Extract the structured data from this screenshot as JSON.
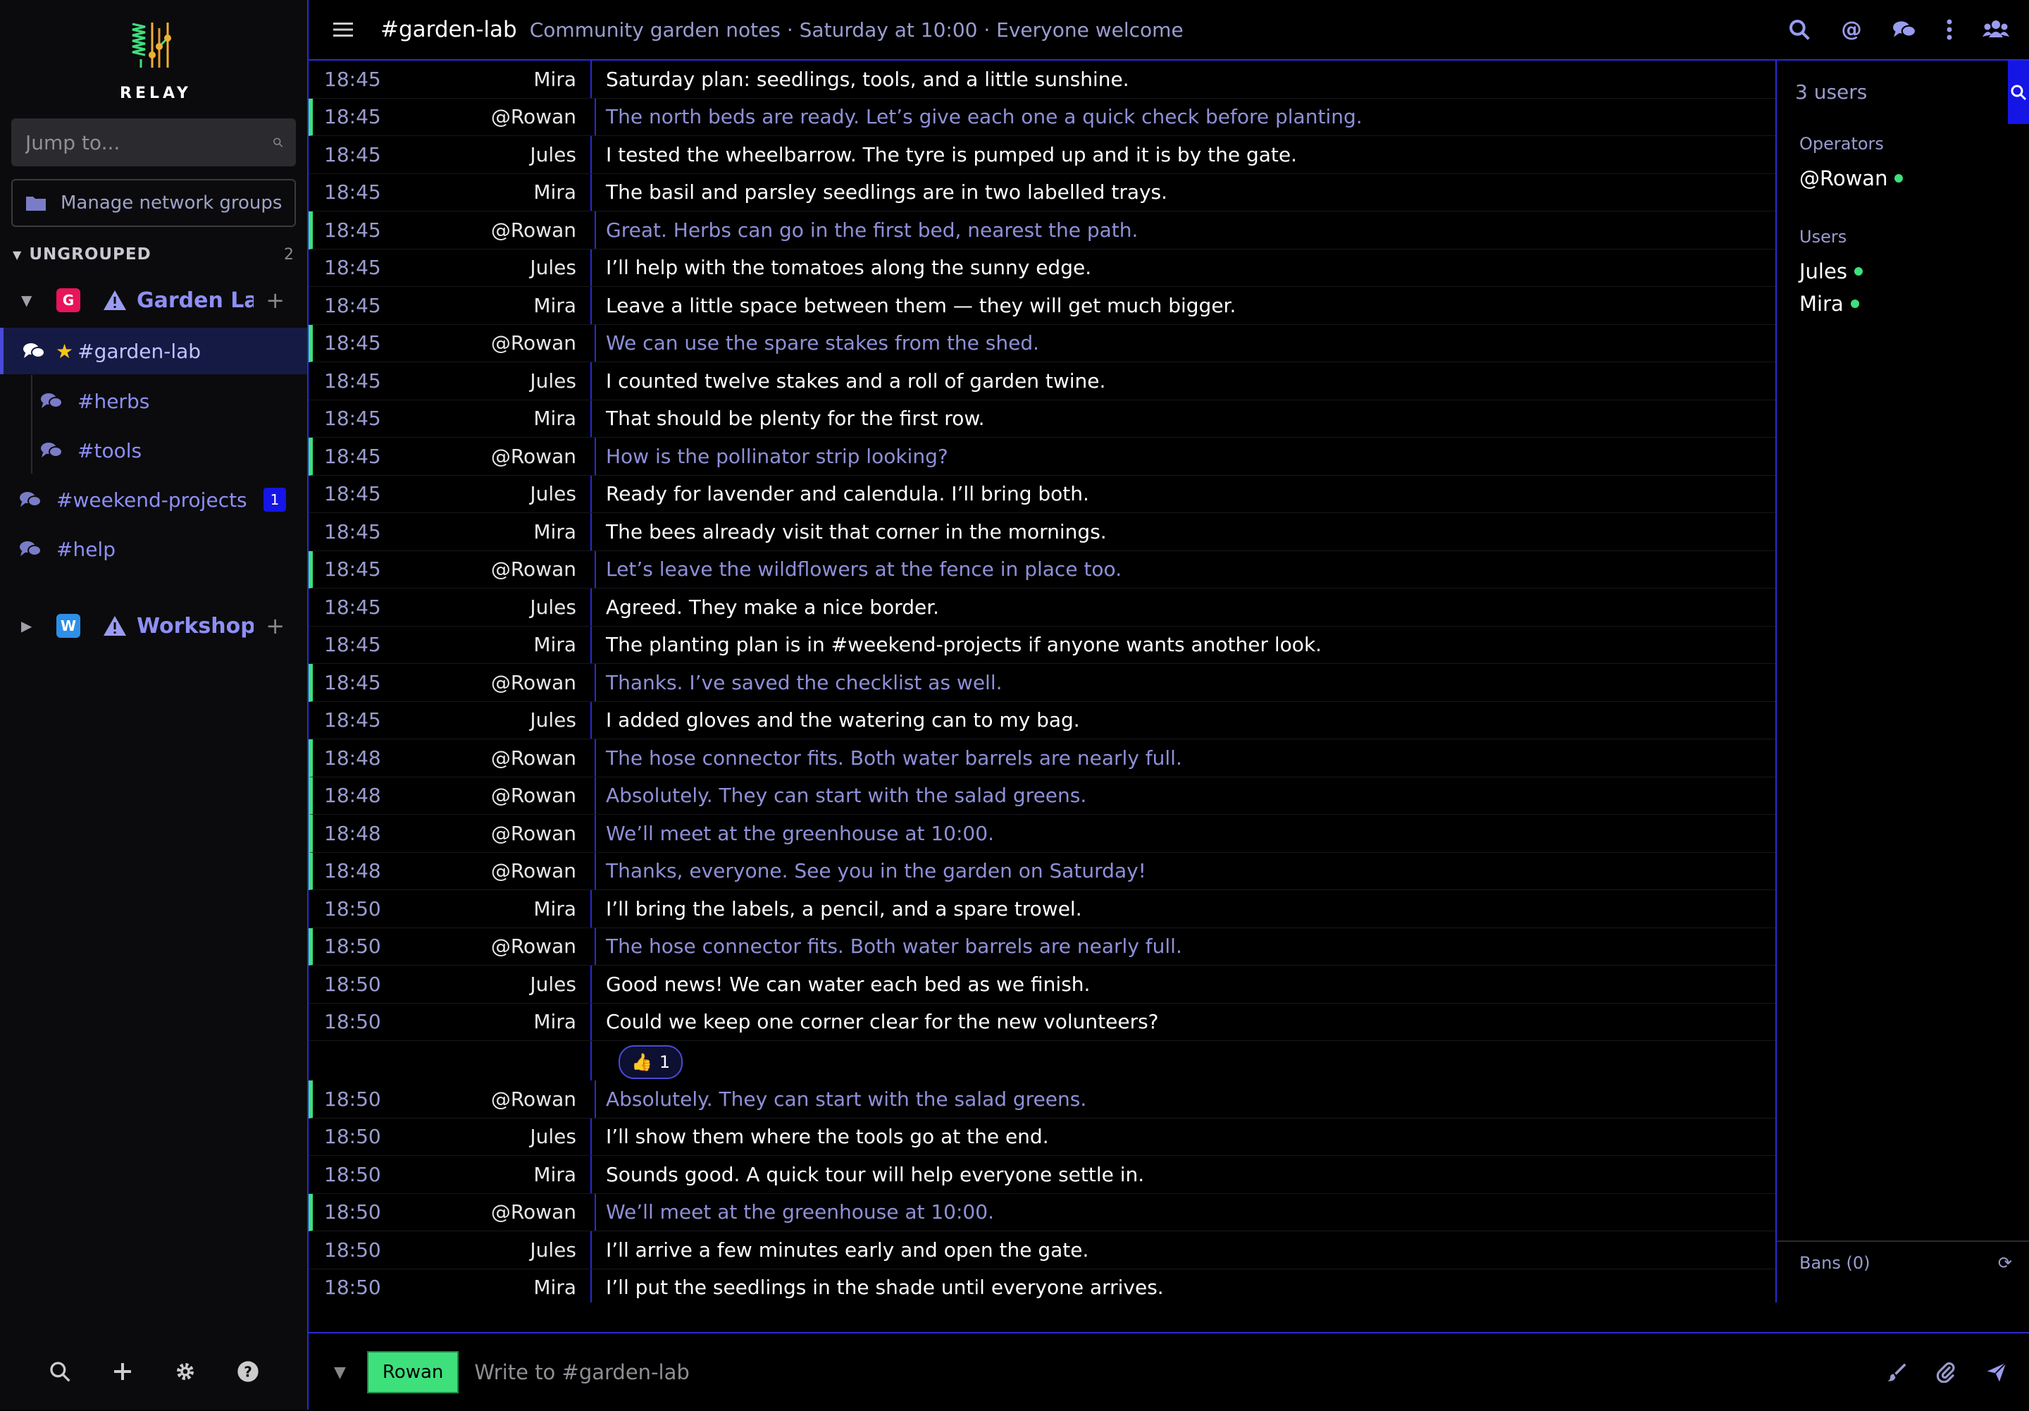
{
  "app": {
    "logo_text": "RELAY"
  },
  "sidebar": {
    "jump_placeholder": "Jump to...",
    "manage_label": "Manage network groups",
    "group_label": "UNGROUPED",
    "group_count": "2",
    "networks": [
      {
        "letter": "G",
        "name": "Garden Lab",
        "color": "#e8155a",
        "expanded": true
      },
      {
        "letter": "W",
        "name": "Workshop",
        "color": "#2d8fe8",
        "expanded": false
      }
    ],
    "channels": [
      {
        "name": "#garden-lab",
        "active": true,
        "starred": true
      },
      {
        "name": "#herbs"
      },
      {
        "name": "#tools"
      },
      {
        "name": "#weekend-projects",
        "unread": "1"
      },
      {
        "name": "#help"
      }
    ]
  },
  "topbar": {
    "channel": "#garden-lab",
    "topic": "Community garden notes · Saturday at 10:00 · Everyone welcome"
  },
  "messages": [
    {
      "time": "18:45",
      "nick": "Mira",
      "text": "Saturday plan: seedlings, tools, and a little sunshine.",
      "self": false
    },
    {
      "time": "18:45",
      "nick": "@Rowan",
      "text": "The north beds are ready. Let’s give each one a quick check before planting.",
      "self": true
    },
    {
      "time": "18:45",
      "nick": "Jules",
      "text": "I tested the wheelbarrow. The tyre is pumped up and it is by the gate.",
      "self": false
    },
    {
      "time": "18:45",
      "nick": "Mira",
      "text": "The basil and parsley seedlings are in two labelled trays.",
      "self": false
    },
    {
      "time": "18:45",
      "nick": "@Rowan",
      "text": "Great. Herbs can go in the first bed, nearest the path.",
      "self": true
    },
    {
      "time": "18:45",
      "nick": "Jules",
      "text": "I’ll help with the tomatoes along the sunny edge.",
      "self": false
    },
    {
      "time": "18:45",
      "nick": "Mira",
      "text": "Leave a little space between them — they will get much bigger.",
      "self": false
    },
    {
      "time": "18:45",
      "nick": "@Rowan",
      "text": "We can use the spare stakes from the shed.",
      "self": true
    },
    {
      "time": "18:45",
      "nick": "Jules",
      "text": "I counted twelve stakes and a roll of garden twine.",
      "self": false
    },
    {
      "time": "18:45",
      "nick": "Mira",
      "text": "That should be plenty for the first row.",
      "self": false
    },
    {
      "time": "18:45",
      "nick": "@Rowan",
      "text": "How is the pollinator strip looking?",
      "self": true
    },
    {
      "time": "18:45",
      "nick": "Jules",
      "text": "Ready for lavender and calendula. I’ll bring both.",
      "self": false
    },
    {
      "time": "18:45",
      "nick": "Mira",
      "text": "The bees already visit that corner in the mornings.",
      "self": false
    },
    {
      "time": "18:45",
      "nick": "@Rowan",
      "text": "Let’s leave the wildflowers at the fence in place too.",
      "self": true
    },
    {
      "time": "18:45",
      "nick": "Jules",
      "text": "Agreed. They make a nice border.",
      "self": false
    },
    {
      "time": "18:45",
      "nick": "Mira",
      "text": "The planting plan is in #weekend-projects if anyone wants another look.",
      "self": false
    },
    {
      "time": "18:45",
      "nick": "@Rowan",
      "text": "Thanks. I’ve saved the checklist as well.",
      "self": true
    },
    {
      "time": "18:45",
      "nick": "Jules",
      "text": "I added gloves and the watering can to my bag.",
      "self": false
    },
    {
      "time": "18:48",
      "nick": "@Rowan",
      "text": "The hose connector fits. Both water barrels are nearly full.",
      "self": true
    },
    {
      "time": "18:48",
      "nick": "@Rowan",
      "text": "Absolutely. They can start with the salad greens.",
      "self": true
    },
    {
      "time": "18:48",
      "nick": "@Rowan",
      "text": "We’ll meet at the greenhouse at 10:00.",
      "self": true
    },
    {
      "time": "18:48",
      "nick": "@Rowan",
      "text": "Thanks, everyone. See you in the garden on Saturday!",
      "self": true
    },
    {
      "time": "18:50",
      "nick": "Mira",
      "text": "I’ll bring the labels, a pencil, and a spare trowel.",
      "self": false
    },
    {
      "time": "18:50",
      "nick": "@Rowan",
      "text": "The hose connector fits. Both water barrels are nearly full.",
      "self": true
    },
    {
      "time": "18:50",
      "nick": "Jules",
      "text": "Good news! We can water each bed as we finish.",
      "self": false
    },
    {
      "time": "18:50",
      "nick": "Mira",
      "text": "Could we keep one corner clear for the new volunteers?",
      "self": false,
      "reaction": {
        "emoji": "👍",
        "count": "1"
      }
    },
    {
      "time": "18:50",
      "nick": "@Rowan",
      "text": "Absolutely. They can start with the salad greens.",
      "self": true
    },
    {
      "time": "18:50",
      "nick": "Jules",
      "text": "I’ll show them where the tools go at the end.",
      "self": false
    },
    {
      "time": "18:50",
      "nick": "Mira",
      "text": "Sounds good. A quick tour will help everyone settle in.",
      "self": false
    },
    {
      "time": "18:50",
      "nick": "@Rowan",
      "text": "We’ll meet at the greenhouse at 10:00.",
      "self": true
    },
    {
      "time": "18:50",
      "nick": "Jules",
      "text": "I’ll arrive a few minutes early and open the gate.",
      "self": false
    },
    {
      "time": "18:50",
      "nick": "Mira",
      "text": "I’ll put the seedlings in the shade until everyone arrives.",
      "self": false
    }
  ],
  "userlist": {
    "count_label": "3 users",
    "operators_label": "Operators",
    "operators": [
      "@Rowan"
    ],
    "users_label": "Users",
    "users": [
      "Jules",
      "Mira"
    ],
    "bans_label": "Bans (0)"
  },
  "composer": {
    "nick": "Rowan",
    "placeholder": "Write to #garden-lab"
  },
  "colors": {
    "accent": "#2a2ad6",
    "self": "#3ee07c",
    "link": "#8e8ff5"
  }
}
